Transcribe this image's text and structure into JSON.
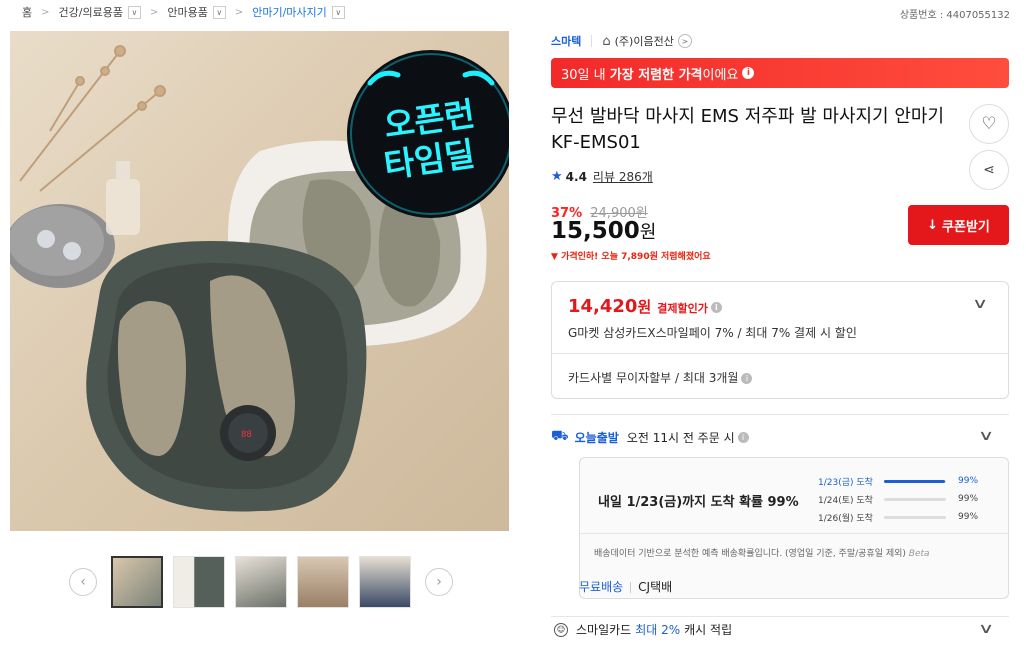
{
  "breadcrumb": {
    "items": [
      "홈",
      "건강/의료용품",
      "안마용품",
      "안마기/마사지기"
    ]
  },
  "product_no": "상품번호 : 4407055132",
  "hero_badge": {
    "line1": "오픈런",
    "line2": "타임딜"
  },
  "seller": {
    "brand": "스마텍",
    "shop": "(주)이음전산"
  },
  "lowest_price": {
    "pre": "30일 내 ",
    "strong": "가장 저렴한 가격",
    "post": "이에요"
  },
  "title": "무선 발바닥 마사지 EMS 저주파 발 마사지기 안마기 KF-EMS01",
  "rating": {
    "score": "4.4",
    "review_label": "리뷰",
    "review_count": "286개"
  },
  "price": {
    "discount": "37%",
    "original": "24,900원",
    "current": "15,500",
    "unit": "원",
    "drop_note": "가격인하! 오늘 7,890원 저렴해졌어요"
  },
  "coupon_label": "쿠폰받기",
  "card_box": {
    "price": "14,420",
    "unit": "원",
    "label": "결제할인가",
    "desc": "G마켓 삼성카드X스마일페이 7% / 최대 7% 결제 시 할인",
    "install": "카드사별 무이자할부 / 최대 3개월"
  },
  "delivery": {
    "today_label": "오늘출발",
    "today_text": "오전 11시 전 주문 시",
    "headline": "내일 1/23(금)까지 도착 확률 99%",
    "rows": [
      {
        "date": "1/23(금) 도착",
        "pct": "99%",
        "fill": 0.99
      },
      {
        "date": "1/24(토) 도착",
        "pct": "99%",
        "fill": 0
      },
      {
        "date": "1/26(월) 도착",
        "pct": "99%",
        "fill": 0
      }
    ],
    "note": "배송데이터 기반으로 분석한 예측 배송확률입니다. (영업일 기준, 주말/공휴일 제외)",
    "beta": "Beta",
    "free_label": "무료배송",
    "courier": "CJ택배"
  },
  "smile_card": {
    "pre": "스마일카드",
    "accent": "최대 2%",
    "post": "캐시 적립"
  },
  "colors": {
    "accent_blue": "#1a5fd8",
    "accent_red": "#e4171b"
  }
}
